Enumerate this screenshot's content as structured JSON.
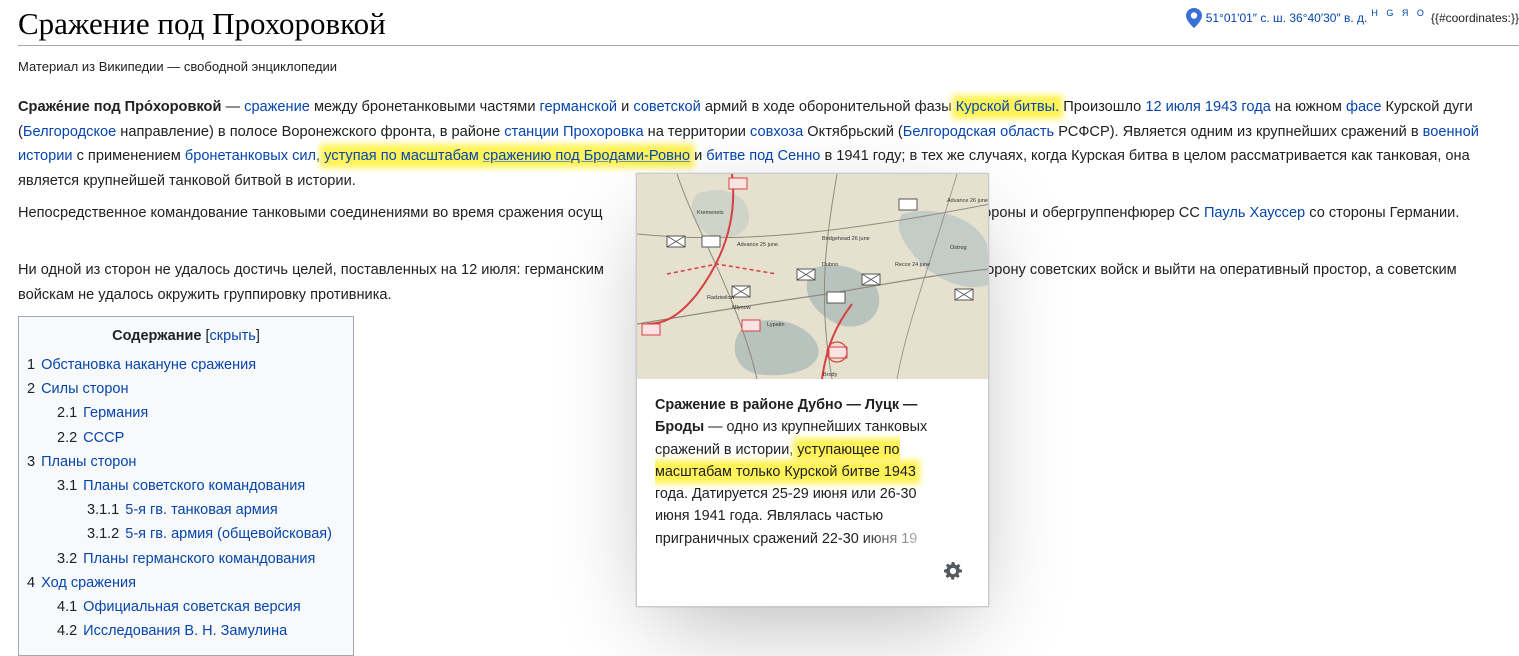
{
  "header": {
    "title": "Сражение под Прохоровкой",
    "coords": {
      "text": "51°01′01″ с. ш. 36°40′30″ в. д.",
      "links": "H G Я O",
      "template": "{{#coordinates:}}"
    },
    "tagline": "Материал из Википедии — свободной энциклопедии"
  },
  "p1": {
    "b1": "Сраже́ние под Про́хоровкой",
    "t1": " — ",
    "a1": "сражение",
    "t2": " между бронетанковыми частями ",
    "a2": "германской",
    "t3": " и ",
    "a3": "советской",
    "t4": " армий в ходе оборонительной фазы ",
    "a4": "Курской битвы.",
    "t5": " Произошло ",
    "a5": "12 июля 1943 года",
    "t6": " на южном ",
    "a6": "фасе",
    "t7": " Курской дуги (",
    "a7": "Белгородское",
    "t8": " направление) в полосе Воронежского фронта, в районе ",
    "a8": "станции Прохоровка",
    "t9": " на территории ",
    "a9": "совхоза",
    "t10": " Октябрьский (",
    "a10": "Белгородская область",
    "t11": " РСФСР). Является одним из крупнейших сражений в ",
    "a11": "военной истории",
    "t12": " с применением ",
    "a12": "бронетанковых сил",
    "t13": ", ",
    "a13": "уступая по масштабам ",
    "a14": "сражению под Бродами-Ровно",
    "t14": " и ",
    "a15": "битве под Сенно",
    "t15": " в 1941 году; в тех же случаях, когда Курская битва в целом рассматривается как танковая, она является крупнейшей танковой битвой в истории."
  },
  "p2": {
    "t1": "Непосредственное командование танковыми соединениями во время сражения осущ",
    "t2": "с советской стороны и обергруппенфюрер СС ",
    "a1": "Пауль Хауссер",
    "t3": " со стороны Германии."
  },
  "p3": {
    "t1": "Ни одной из сторон не удалось достичь целей, поставленных на 12 июля: германским",
    "t2": "вать оборону советских войск и выйти на оперативный простор, а советским войскам не удалось окружить группировку противника."
  },
  "toc": {
    "title": "Содержание",
    "toggle_open": "[",
    "toggle": "скрыть",
    "toggle_close": "]",
    "items": [
      {
        "num": "1",
        "label": "Обстановка накануне сражения",
        "level": 1
      },
      {
        "num": "2",
        "label": "Силы сторон",
        "level": 1
      },
      {
        "num": "2.1",
        "label": "Германия",
        "level": 2
      },
      {
        "num": "2.2",
        "label": "СССР",
        "level": 2
      },
      {
        "num": "3",
        "label": "Планы сторон",
        "level": 1
      },
      {
        "num": "3.1",
        "label": "Планы советского командования",
        "level": 2
      },
      {
        "num": "3.1.1",
        "label": "5-я гв. танковая армия",
        "level": 3
      },
      {
        "num": "3.1.2",
        "label": "5-я гв. армия (общевойсковая)",
        "level": 3
      },
      {
        "num": "3.2",
        "label": "Планы германского командования",
        "level": 2
      },
      {
        "num": "4",
        "label": "Ход сражения",
        "level": 1
      },
      {
        "num": "4.1",
        "label": "Официальная советская версия",
        "level": 2
      },
      {
        "num": "4.2",
        "label": "Исследования В. Н. Замулина",
        "level": 2
      }
    ]
  },
  "popup": {
    "bold": "Сражение в районе Дубно — Луцк — Броды",
    "t1": " — одно из крупнейших танковых сражений в истории, ",
    "hl": "уступающее по масштабам только Курской битве 1943",
    "t2": " года. Датируется 25-29 июня или 26-30 июня 1941 года. Являлась частью приграничных сражений 22-30 июня 19",
    "map_labels": {
      "l1": "Advance 25 june",
      "l2": "Advance 26 june",
      "l3": "Bridgehead 26 june",
      "l4": "Recce 24 june",
      "l5": "Ostrog",
      "l6": "Brody",
      "l7": "Dubno",
      "l8": "Radziwilow",
      "l9": "Mlynow",
      "l10": "Lypatin",
      "l11": "Kremenets"
    }
  }
}
